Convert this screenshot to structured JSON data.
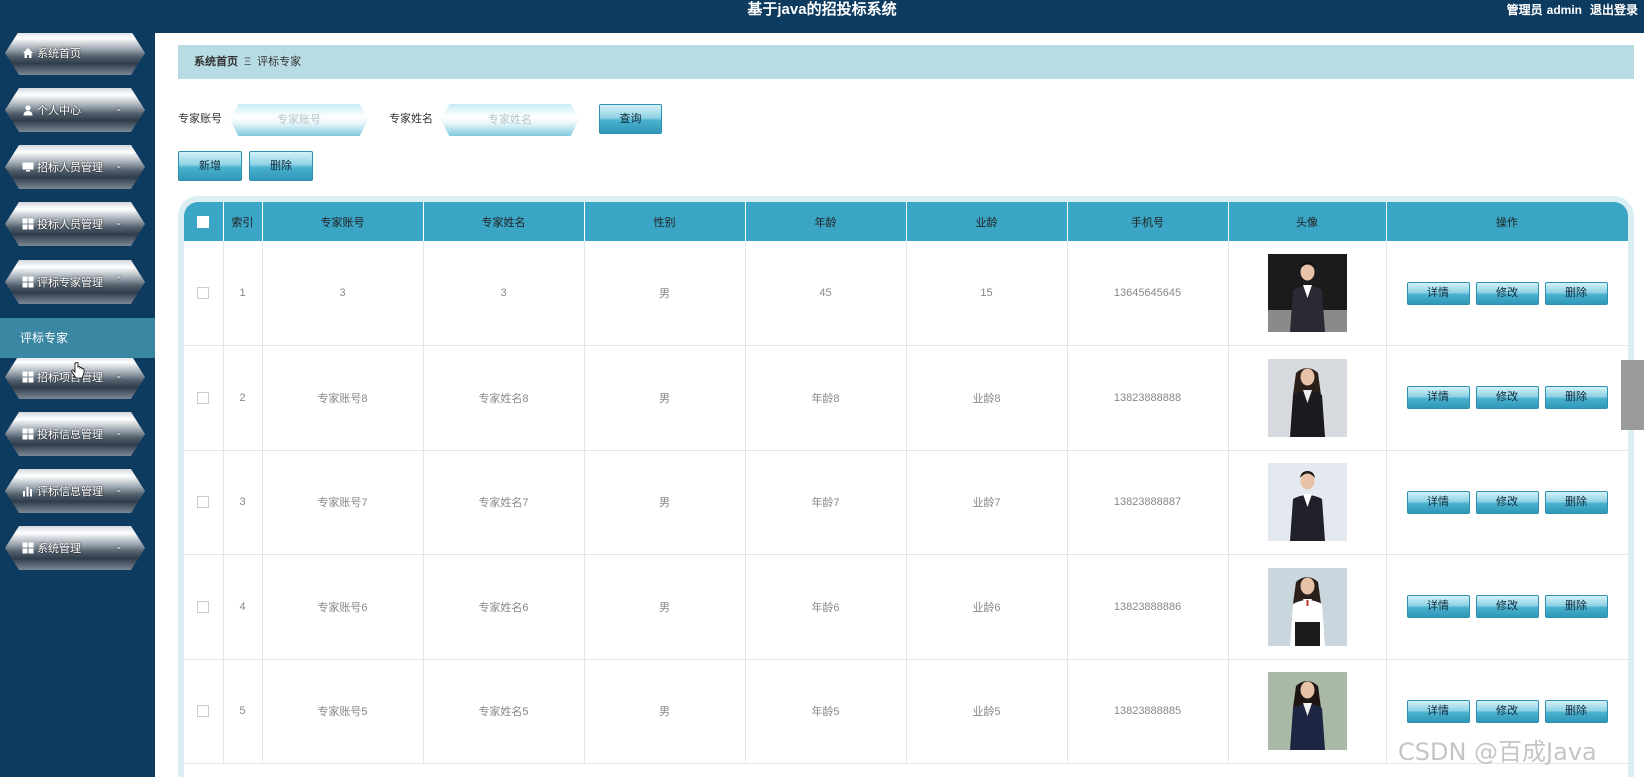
{
  "header": {
    "title": "基于java的招投标系统",
    "user_role": "管理员",
    "username": "admin",
    "logout": "退出登录"
  },
  "sidebar": {
    "items": [
      {
        "label": "系统首页",
        "icon": "home-icon",
        "has_chevron": false
      },
      {
        "label": "个人中心",
        "icon": "user-icon",
        "has_chevron": true
      },
      {
        "label": "招标人员管理",
        "icon": "monitor-icon",
        "has_chevron": true
      },
      {
        "label": "投标人员管理",
        "icon": "grid-icon",
        "has_chevron": true
      },
      {
        "label": "评标专家管理",
        "icon": "grid-icon",
        "has_chevron": true,
        "expanded": true
      },
      {
        "label": "招标项目管理",
        "icon": "grid-icon",
        "has_chevron": true
      },
      {
        "label": "投标信息管理",
        "icon": "grid-icon",
        "has_chevron": true
      },
      {
        "label": "评标信息管理",
        "icon": "bar-chart-icon",
        "has_chevron": true
      },
      {
        "label": "系统管理",
        "icon": "grid-icon",
        "has_chevron": true
      }
    ],
    "submenu_active": "评标专家"
  },
  "breadcrumb": {
    "home": "系统首页",
    "separator": "Ξ",
    "current": "评标专家"
  },
  "search": {
    "account_label": "专家账号",
    "account_placeholder": "专家账号",
    "name_label": "专家姓名",
    "name_placeholder": "专家姓名",
    "query_button": "查询"
  },
  "actions": {
    "add": "新增",
    "delete": "删除"
  },
  "table": {
    "headers": [
      "",
      "索引",
      "专家账号",
      "专家姓名",
      "性别",
      "年龄",
      "业龄",
      "手机号",
      "头像",
      "操作"
    ],
    "row_buttons": {
      "detail": "详情",
      "edit": "修改",
      "delete": "删除"
    },
    "rows": [
      {
        "index": "1",
        "account": "3",
        "name": "3",
        "gender": "男",
        "age": "45",
        "work_age": "15",
        "phone": "13645645645",
        "avatar": "man-dark-background"
      },
      {
        "index": "2",
        "account": "专家账号8",
        "name": "专家姓名8",
        "gender": "男",
        "age": "年龄8",
        "work_age": "业龄8",
        "phone": "13823888888",
        "avatar": "woman-black-suit"
      },
      {
        "index": "3",
        "account": "专家账号7",
        "name": "专家姓名7",
        "gender": "男",
        "age": "年龄7",
        "work_age": "业龄7",
        "phone": "13823888887",
        "avatar": "man-black-suit"
      },
      {
        "index": "4",
        "account": "专家账号6",
        "name": "专家姓名6",
        "gender": "男",
        "age": "年龄6",
        "work_age": "业龄6",
        "phone": "13823888886",
        "avatar": "woman-office"
      },
      {
        "index": "5",
        "account": "专家账号5",
        "name": "专家姓名5",
        "gender": "男",
        "age": "年龄5",
        "work_age": "业龄5",
        "phone": "13823888885",
        "avatar": "woman-navy-suit"
      }
    ]
  },
  "watermark": "CSDN @百成Java",
  "colors": {
    "sidebar_bg": "#0d3a5f",
    "header_bg": "#0d3a5f",
    "breadcrumb_bg": "#b8dce3",
    "table_header_bg": "#3aa5c4",
    "submenu_active_bg": "#3a87a4"
  }
}
